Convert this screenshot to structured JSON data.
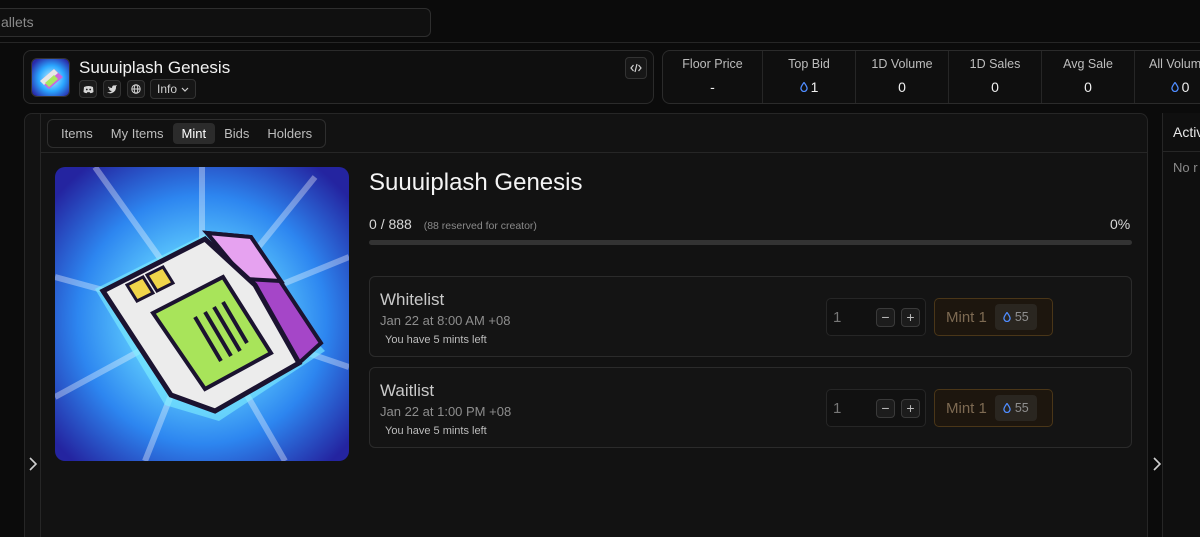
{
  "search": {
    "placeholder": "allets"
  },
  "collection": {
    "name": "Suuuiplash Genesis",
    "info_label": "Info",
    "socials": [
      "discord-icon",
      "twitter-icon",
      "globe-icon"
    ]
  },
  "stats": [
    {
      "label": "Floor Price",
      "value": "-",
      "icon": false
    },
    {
      "label": "Top Bid",
      "value": "1",
      "icon": true
    },
    {
      "label": "1D Volume",
      "value": "0",
      "icon": false
    },
    {
      "label": "1D Sales",
      "value": "0",
      "icon": false
    },
    {
      "label": "Avg Sale",
      "value": "0",
      "icon": false
    },
    {
      "label": "All Volum",
      "value": "0",
      "icon": true
    }
  ],
  "tabs": [
    {
      "label": "Items",
      "active": false
    },
    {
      "label": "My Items",
      "active": false
    },
    {
      "label": "Mint",
      "active": true
    },
    {
      "label": "Bids",
      "active": false
    },
    {
      "label": "Holders",
      "active": false
    }
  ],
  "mint": {
    "title": "Suuuiplash Genesis",
    "minted": "0",
    "separator": "/",
    "supply": "888",
    "reserved_note": "(88 reserved for creator)",
    "percent": "0%",
    "progress_fraction": 0,
    "phases": [
      {
        "name": "Whitelist",
        "time": "Jan 22 at 8:00 AM +08",
        "mints_left": "You have 5 mints left",
        "quantity": "1",
        "button_label": "Mint 1",
        "price": "55"
      },
      {
        "name": "Waitlist",
        "time": "Jan 22 at 1:00 PM +08",
        "mints_left": "You have 5 mints left",
        "quantity": "1",
        "button_label": "Mint 1",
        "price": "55"
      }
    ]
  },
  "activity": {
    "title": "Activ",
    "empty_text": "No r"
  },
  "colors": {
    "accent_orange": "#4a3618",
    "sui_blue": "#4f8cff",
    "background": "#0b0b0b"
  }
}
